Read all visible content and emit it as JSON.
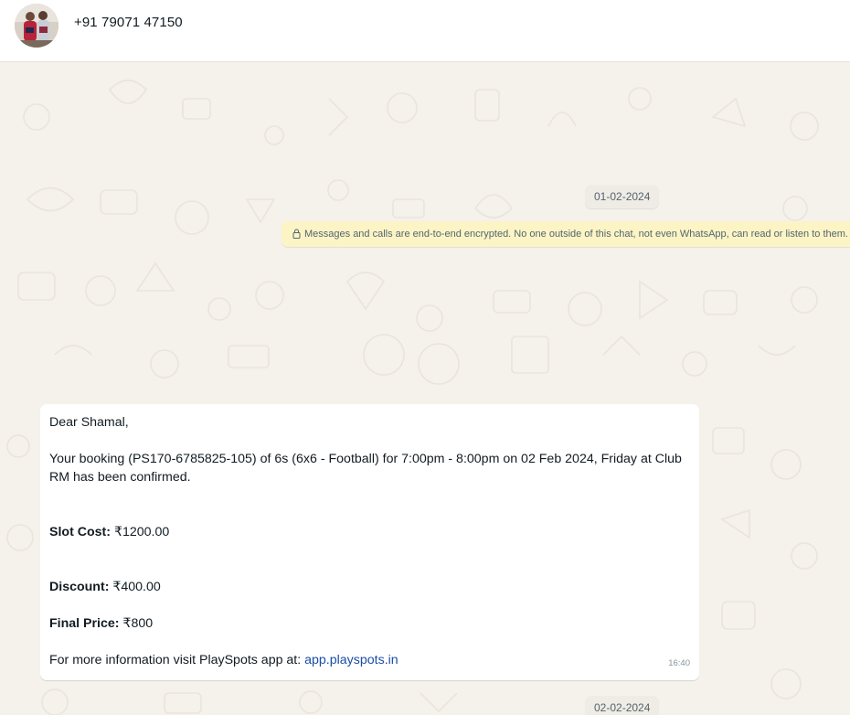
{
  "header": {
    "contact_name": "+91 79071 47150",
    "avatar_icon": "avatar-photo"
  },
  "chat": {
    "date_chip_1": "01-02-2024",
    "encryption_notice": "Messages and calls are end-to-end encrypted. No one outside of this chat, not even WhatsApp, can read or listen to them.",
    "message": {
      "greeting": "Dear Shamal,",
      "booking_text": "Your booking (PS170-6785825-105) of 6s (6x6 - Football) for 7:00pm - 8:00pm on 02 Feb 2024, Friday at Club RM has been confirmed.",
      "slot_cost_label": "Slot Cost:",
      "slot_cost_value": " ₹1200.00",
      "discount_label": "Discount:",
      "discount_value": " ₹400.00",
      "final_price_label": "Final Price:",
      "final_price_value": " ₹800",
      "more_info_text": "For more information visit PlaySpots app at: ",
      "more_info_link": "app.playspots.in",
      "time": "16:40"
    },
    "date_chip_2": "02-02-2024"
  },
  "colors": {
    "chat_background": "#f5f1eb",
    "notice_background": "#fdf4c5",
    "link": "#1a4ea5"
  }
}
